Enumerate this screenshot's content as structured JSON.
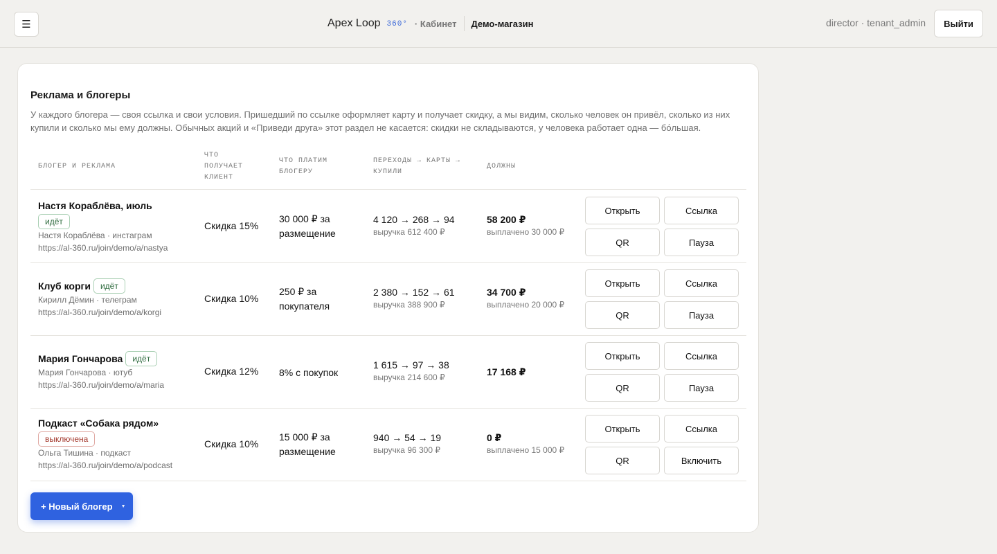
{
  "header": {
    "menu_icon": "☰",
    "app_name": "Apex Loop",
    "app_badge": "360°",
    "section": "· Кабинет",
    "store_name": "Демо-магазин",
    "user": "director · tenant_admin",
    "logout_label": "Выйти"
  },
  "section": {
    "title": "Реклама и блогеры",
    "description": "У каждого блогера — своя ссылка и свои условия. Пришедший по ссылке оформляет карту и получает скидку, а мы видим, сколько человек он привёл, сколько из них купили и сколько мы ему должны. Обычных акций и «Приведи друга» этот раздел не касается: скидки не складываются, у человека работает одна — бо́льшая."
  },
  "table": {
    "columns": {
      "blogger": "БЛОГЕР И РЕКЛАМА",
      "client_gets": "ЧТО ПОЛУЧАЕТ КЛИЕНТ",
      "we_pay": "ЧТО ПЛАТИМ БЛОГЕРУ",
      "conversions": "ПЕРЕХОДЫ → КАРТЫ → КУПИЛИ",
      "owed": "ДОЛЖНЫ"
    },
    "rows": [
      {
        "name": "Настя Кораблёва, июль",
        "status": "идёт",
        "status_off": false,
        "author": "Настя Кораблёва · инстаграм",
        "link": "https://al-360.ru/join/demo/a/nastya",
        "client_gets": "Скидка 15%",
        "we_pay": "30 000 ₽ за размещение",
        "conversions": "4 120 → 268 → 94",
        "revenue": "выручка 612 400 ₽",
        "owed": "58 200 ₽",
        "paid": "выплачено 30 000 ₽",
        "btn_open": "Открыть",
        "btn_link": "Ссылка",
        "btn_qr": "QR",
        "btn_toggle": "Пауза"
      },
      {
        "name": "Клуб корги",
        "status": "идёт",
        "status_off": false,
        "author": "Кирилл Дёмин · телеграм",
        "link": "https://al-360.ru/join/demo/a/korgi",
        "client_gets": "Скидка 10%",
        "we_pay": "250 ₽ за покупателя",
        "conversions": "2 380 → 152 → 61",
        "revenue": "выручка 388 900 ₽",
        "owed": "34 700 ₽",
        "paid": "выплачено 20 000 ₽",
        "btn_open": "Открыть",
        "btn_link": "Ссылка",
        "btn_qr": "QR",
        "btn_toggle": "Пауза"
      },
      {
        "name": "Мария Гончарова",
        "status": "идёт",
        "status_off": false,
        "author": "Мария Гончарова · ютуб",
        "link": "https://al-360.ru/join/demo/a/maria",
        "client_gets": "Скидка 12%",
        "we_pay": "8% с покупок",
        "conversions": "1 615 → 97 → 38",
        "revenue": "выручка 214 600 ₽",
        "owed": "17 168 ₽",
        "paid": "",
        "btn_open": "Открыть",
        "btn_link": "Ссылка",
        "btn_qr": "QR",
        "btn_toggle": "Пауза"
      },
      {
        "name": "Подкаст «Собака рядом»",
        "status": "выключена",
        "status_off": true,
        "author": "Ольга Тишина · подкаст",
        "link": "https://al-360.ru/join/demo/a/podcast",
        "client_gets": "Скидка 10%",
        "we_pay": "15 000 ₽ за размещение",
        "conversions": "940 → 54 → 19",
        "revenue": "выручка 96 300 ₽",
        "owed": "0 ₽",
        "paid": "выплачено 15 000 ₽",
        "btn_open": "Открыть",
        "btn_link": "Ссылка",
        "btn_qr": "QR",
        "btn_toggle": "Включить"
      }
    ]
  },
  "new_blogger": {
    "label": "+ Новый блогер",
    "caret": "▼"
  }
}
